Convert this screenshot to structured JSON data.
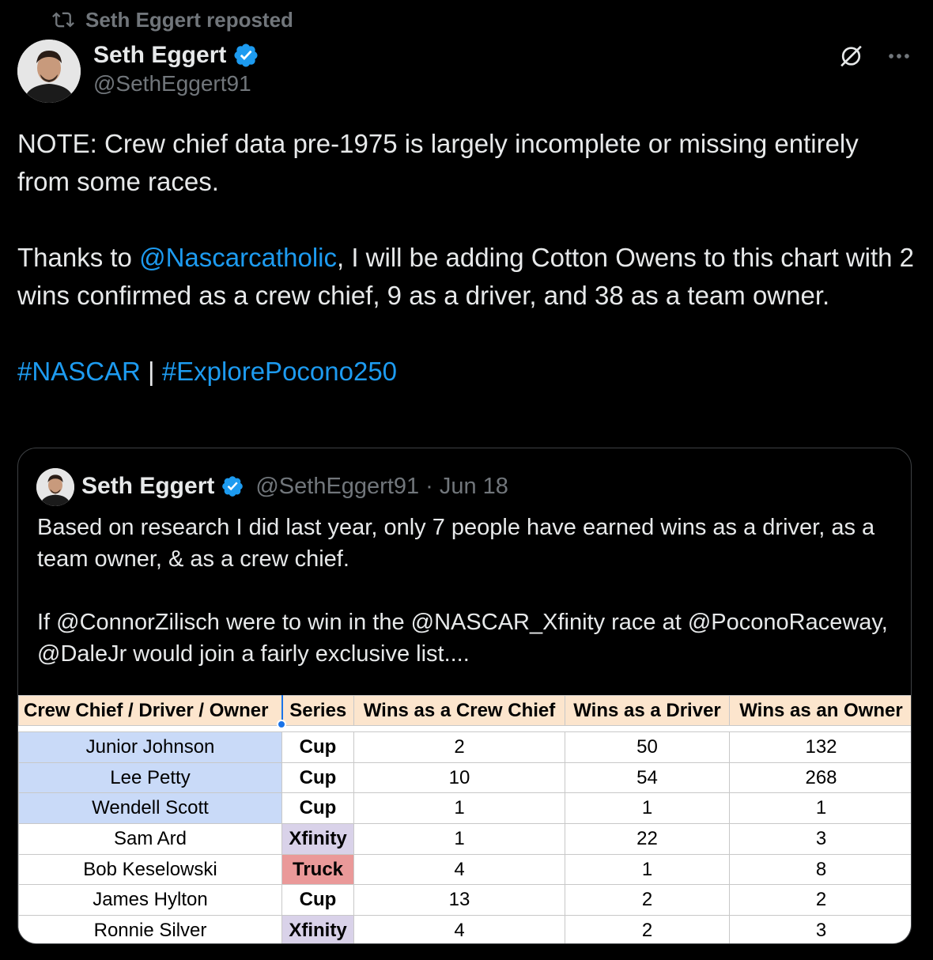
{
  "repost": {
    "text": "Seth Eggert reposted"
  },
  "author": {
    "name": "Seth Eggert",
    "handle": "@SethEggert91"
  },
  "tweet": {
    "line1": "NOTE: Crew chief data pre-1975 is largely incomplete or missing entirely from some races.",
    "line2_prefix": "Thanks to ",
    "line2_mention": "@Nascarcatholic",
    "line2_suffix": ", I will be adding Cotton Owens to this chart with 2 wins confirmed as a crew chief, 9 as a driver, and 38 as a team owner.",
    "hashtag1": "#NASCAR",
    "separator": " | ",
    "hashtag2": "#ExplorePocono250"
  },
  "quote": {
    "name": "Seth Eggert",
    "handle": "@SethEggert91",
    "dot": "·",
    "date": "Jun 18",
    "para1": "Based on research I did last year, only 7 people have earned wins as a driver, as a team owner, & as a crew chief.",
    "para2": "If @ConnorZilisch were to win in the @NASCAR_Xfinity race at @PoconoRaceway, @DaleJr would join a fairly exclusive list...."
  },
  "table": {
    "headers": [
      "Crew Chief / Driver / Owner",
      "Series",
      "Wins as a Crew Chief",
      "Wins as a Driver",
      "Wins as an Owner"
    ],
    "rows": [
      [
        "Junior Johnson",
        "Cup",
        "2",
        "50",
        "132"
      ],
      [
        "Lee Petty",
        "Cup",
        "10",
        "54",
        "268"
      ],
      [
        "Wendell Scott",
        "Cup",
        "1",
        "1",
        "1"
      ],
      [
        "Sam Ard",
        "Xfinity",
        "1",
        "22",
        "3"
      ],
      [
        "Bob Keselowski",
        "Truck",
        "4",
        "1",
        "8"
      ],
      [
        "James Hylton",
        "Cup",
        "13",
        "2",
        "2"
      ],
      [
        "Ronnie Silver",
        "Xfinity",
        "4",
        "2",
        "3"
      ]
    ]
  },
  "colors": {
    "background": "#000000",
    "text": "#e7e9ea",
    "muted": "#71767b",
    "link": "#1d9bf0",
    "verified": "#1d9bf0",
    "header_fill": "#fce5cd",
    "name_highlight": "#c9daf8",
    "xfinity_fill": "#d9d2e9",
    "truck_fill": "#ea9999"
  },
  "icons": [
    "repost-icon",
    "verified-badge-icon",
    "grok-icon",
    "more-icon"
  ]
}
